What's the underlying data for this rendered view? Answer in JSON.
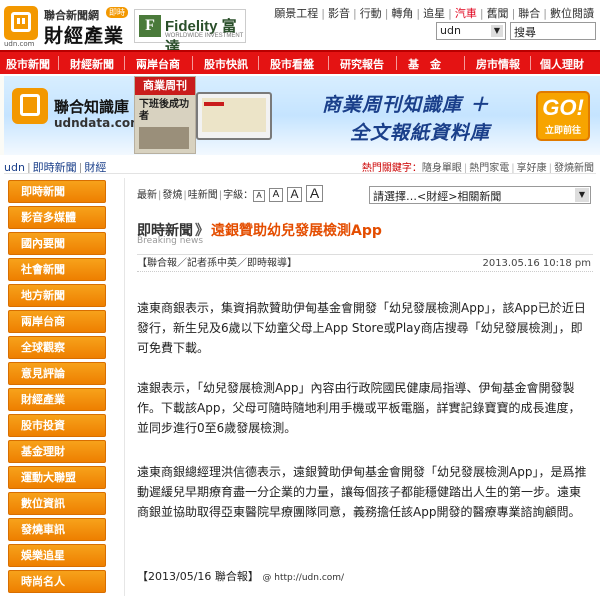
{
  "header": {
    "logo_line1": "聯合新聞網",
    "logo_badge": "即時",
    "logo_line2": "財經產業",
    "logo_sub": "udn.com",
    "ad_name": "Fidelity 富達",
    "ad_sub": "WORLDWIDE INVESTMENT",
    "top_links": [
      "願景工程",
      "影音",
      "行動",
      "轉角",
      "追星",
      "汽車",
      "舊聞",
      "聯合",
      "數位閱讀"
    ],
    "site_select": "udn",
    "search_value": "搜尋"
  },
  "nav": [
    "股市新聞",
    "財經新聞",
    "兩岸台商",
    "股市快訊",
    "股市看盤",
    "研究報告",
    "基　金",
    "房市情報",
    "個人理財"
  ],
  "banner": {
    "brand": "聯合知識庫",
    "brand_sub": "udndata.com",
    "mag_head": "商業周刊",
    "mag_text": "下班後成功者",
    "slogan1": "商業周刊知識庫 ＋",
    "slogan2": "全文報紙資料庫",
    "go": "GO!",
    "go_sub": "立即前往"
  },
  "breadcrumb": [
    "udn",
    "即時新聞",
    "財經"
  ],
  "hot_keywords": {
    "label": "熱門關鍵字：",
    "items": [
      "隨身單眼",
      "熱門家電",
      "享好康",
      "發燒新聞"
    ]
  },
  "sidebar": [
    "即時新聞",
    "影音多媒體",
    "國內要聞",
    "社會新聞",
    "地方新聞",
    "兩岸台商",
    "全球觀察",
    "意見評論",
    "財經產業",
    "股市投資",
    "基金理財",
    "運動大聯盟",
    "數位資訊",
    "發燒車訊",
    "娛樂追星",
    "時尚名人"
  ],
  "toolbar": {
    "items": [
      "最新",
      "發燒",
      "哇新聞",
      "字級："
    ],
    "font_buttons": [
      "A",
      "A",
      "A",
      "A"
    ],
    "related_select": "請選擇…<財經>相關新聞"
  },
  "article": {
    "section": "即時新聞",
    "section_en": "Breaking news",
    "headline": "遠銀贊助幼兒發展檢測App",
    "byline": "【聯合報／記者孫中英／即時報導】",
    "date": "2013.05.16 10:18 pm",
    "paragraphs": [
      "遠東商銀表示，集資捐款贊助伊甸基金會開發「幼兒發展檢測App」，該App已於近日發行，新生兒及6歲以下幼童父母上App Store或Play商店搜尋「幼兒發展檢測」，即可免費下載。",
      "遠銀表示，「幼兒發展檢測App」內容由行政院國民健康局指導、伊甸基金會開發製作。下載該App，父母可隨時隨地利用手機或平板電腦，詳實記錄寶寶的成長進度，並同步進行0至6歲發展檢測。",
      "遠東商銀總經理洪信德表示，遠銀贊助伊甸基金會開發「幼兒發展檢測App」，是爲推動遲緩兒早期療育盡一分企業的力量，讓每個孩子都能穩健踏出人生的第一步。遠東商銀並協助取得亞東醫院早療團隊同意，義務擔任該App開發的醫療專業諮詢顧問。"
    ],
    "source": "【2013/05/16 聯合報】",
    "source_url": "@ http://udn.com/"
  },
  "colors": {
    "nav_red": "#e41313",
    "sidebar_orange": "#ee7f00",
    "headline_orange": "#e44d00"
  }
}
